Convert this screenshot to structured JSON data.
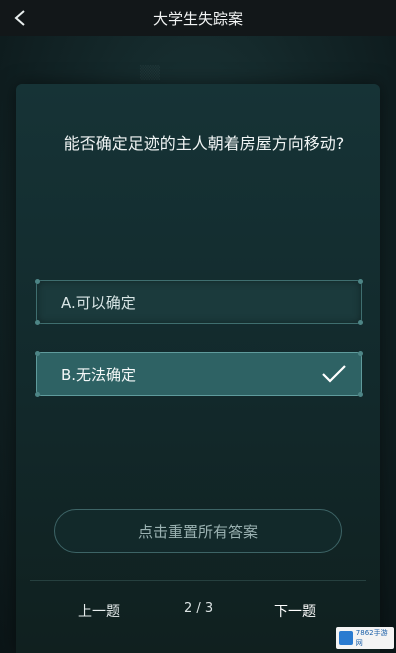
{
  "header": {
    "title": "大学生失踪案"
  },
  "question": {
    "text": "能否确定足迹的主人朝着房屋方向移动?"
  },
  "options": [
    {
      "label": "A.可以确定",
      "selected": false
    },
    {
      "label": "B.无法确定",
      "selected": true
    }
  ],
  "reset": {
    "label": "点击重置所有答案"
  },
  "footer": {
    "prev_label": "上一题",
    "counter": "2 / 3",
    "next_label": "下一题"
  },
  "watermark": {
    "text": "7862手游网"
  },
  "colors": {
    "accent": "#2e6264",
    "option_border": "#5f9b9c",
    "background": "#0c1517"
  },
  "icons": {
    "back": "chevron-left-icon",
    "check": "check-icon"
  }
}
